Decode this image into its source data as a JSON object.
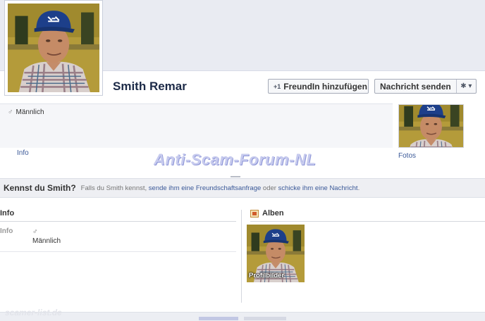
{
  "profile": {
    "name": "Smith Remar"
  },
  "actions": {
    "add_friend_label": "FreundIn hinzufügen",
    "add_friend_icon": "+1",
    "message_label": "Nachricht senden",
    "gear_icon": "✱ ▾"
  },
  "summary": {
    "gender_symbol": "♂",
    "gender": "Männlich",
    "info_link": "Info",
    "fotos_link": "Fotos"
  },
  "watermark": {
    "text": "Anti-Scam-Forum-NL",
    "footer_text": "scamer-list.de"
  },
  "know_bar": {
    "title": "Kennst du Smith?",
    "text_before": "Falls du Smith kennst,",
    "link_request": "sende ihm eine Freundschaftsanfrage",
    "text_middle": "oder",
    "link_message": "schicke ihm eine Nachricht",
    "text_end": "."
  },
  "info_section": {
    "heading": "Info",
    "row_label": "Info",
    "gender_symbol": "♂",
    "gender": "Männlich"
  },
  "albums_section": {
    "heading": "Alben",
    "album_caption": "Profilbilder"
  },
  "colors": {
    "link": "#3b5998",
    "name": "#1c2a47",
    "watermark": "#c7cbee"
  }
}
